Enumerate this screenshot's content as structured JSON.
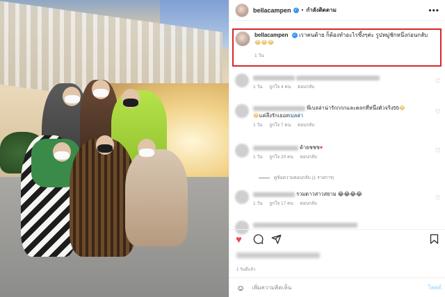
{
  "header": {
    "username": "bellacampen",
    "separator": "•",
    "follow_status": "กำลังติดตาม",
    "more_icon": "more-horizontal-icon"
  },
  "caption": {
    "username": "bellacampen",
    "text": "เราคนด้าย ก็ต้องทำอะไรซึ้งๆค่ะ รูปหมู่ชักหนึ่งก่อนกลับ",
    "emoji": "😂😂😂",
    "time": "1 วัน"
  },
  "comments": [
    {
      "text_tail": "",
      "time": "1 วัน",
      "likes": "ถูกใจ 4 คน",
      "reply": "ตอบกลับ"
    },
    {
      "text_tail": "พี่เบลล่าน่ารักกกกและตลกที่หนึ่งตัวจริง55",
      "line2": "แค่ลึงรักเธอ",
      "mention": "#เบลล่า",
      "time": "1 วัน",
      "likes": "ถูกใจ 7 คน",
      "reply": "ตอบกลับ"
    },
    {
      "text_tail": "ด้ายชชช",
      "time": "1 วัน",
      "likes": "ถูกใจ 20 คน",
      "reply": "ตอบกลับ"
    },
    {
      "text_tail": "รวมดาวสาวสยาม 😂😂😂😂",
      "time": "1 วัน",
      "likes": "ถูกใจ 17 คน",
      "reply": "ตอบกลับ"
    }
  ],
  "view_replies": "ดูข้อความตอบกลับ (1 รายการ)",
  "actions": {
    "like_icon": "heart-filled-icon",
    "comment_icon": "comment-icon",
    "share_icon": "send-icon",
    "save_icon": "bookmark-icon",
    "post_time": "1 วันที่แล้ว"
  },
  "add_comment": {
    "placeholder": "เพิ่มความคิดเห็น",
    "post_label": "โพสต์"
  },
  "colors": {
    "accent": "#3897f0",
    "highlight": "#d6262b",
    "like": "#ed4956"
  }
}
